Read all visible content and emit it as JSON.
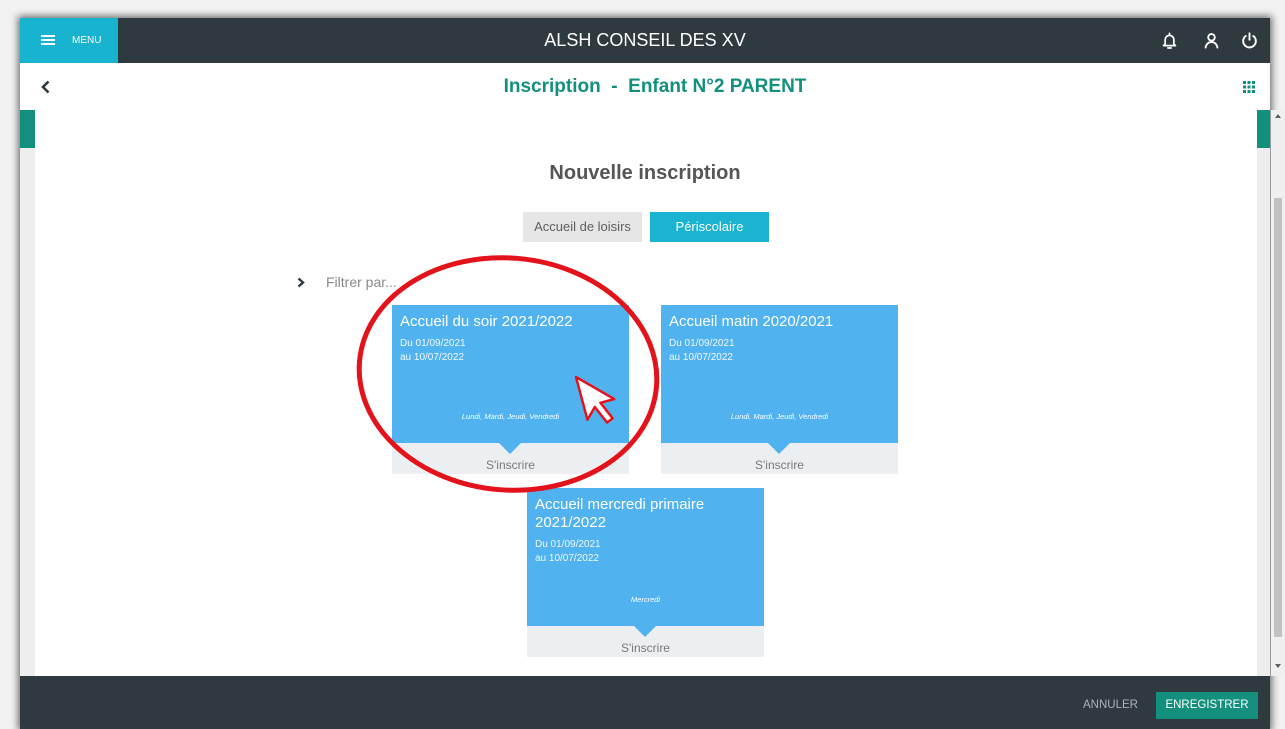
{
  "app": {
    "menu_label": "MENU",
    "title": "ALSH CONSEIL DES XV"
  },
  "icons": {
    "menu": "hamburger-icon",
    "notifications": "bell-icon",
    "account": "user-icon",
    "logout": "power-icon",
    "back": "chevron-left-icon",
    "apps": "grid-icon",
    "filter_toggle": "chevron-right-icon",
    "pointer": "mouse-cursor-icon"
  },
  "subheader": {
    "title": "Inscription  -  Enfant N°2 PARENT"
  },
  "main": {
    "heading": "Nouvelle inscription",
    "tabs": [
      {
        "label": "Accueil de loisirs",
        "active": false
      },
      {
        "label": "Périscolaire",
        "active": true
      }
    ],
    "filter": {
      "label": "Filtrer par..."
    },
    "cards": [
      {
        "title": "Accueil du soir 2021/2022",
        "date_from": "Du 01/09/2021",
        "date_to": "au 10/07/2022",
        "days": "Lundi, Mardi, Jeudi, Vendredi",
        "action": "S'inscrire",
        "highlighted": true
      },
      {
        "title": "Accueil matin 2020/2021",
        "date_from": "Du 01/09/2021",
        "date_to": "au 10/07/2022",
        "days": "Lundi, Mardi, Jeudi, Vendredi",
        "action": "S'inscrire",
        "highlighted": false
      },
      {
        "title": "Accueil mercredi primaire 2021/2022",
        "date_from": "Du 01/09/2021",
        "date_to": "au 10/07/2022",
        "days": "Mercredi",
        "action": "S'inscrire",
        "highlighted": false
      }
    ]
  },
  "footer": {
    "cancel_label": "ANNULER",
    "save_label": "ENREGISTRER"
  },
  "colors": {
    "topbar": "#2e3a40",
    "menu_accent": "#18b3cf",
    "brand_teal": "#12907d",
    "active_tab": "#1ab4d2",
    "card": "#50b2ee",
    "annotation": "#e3131b"
  }
}
